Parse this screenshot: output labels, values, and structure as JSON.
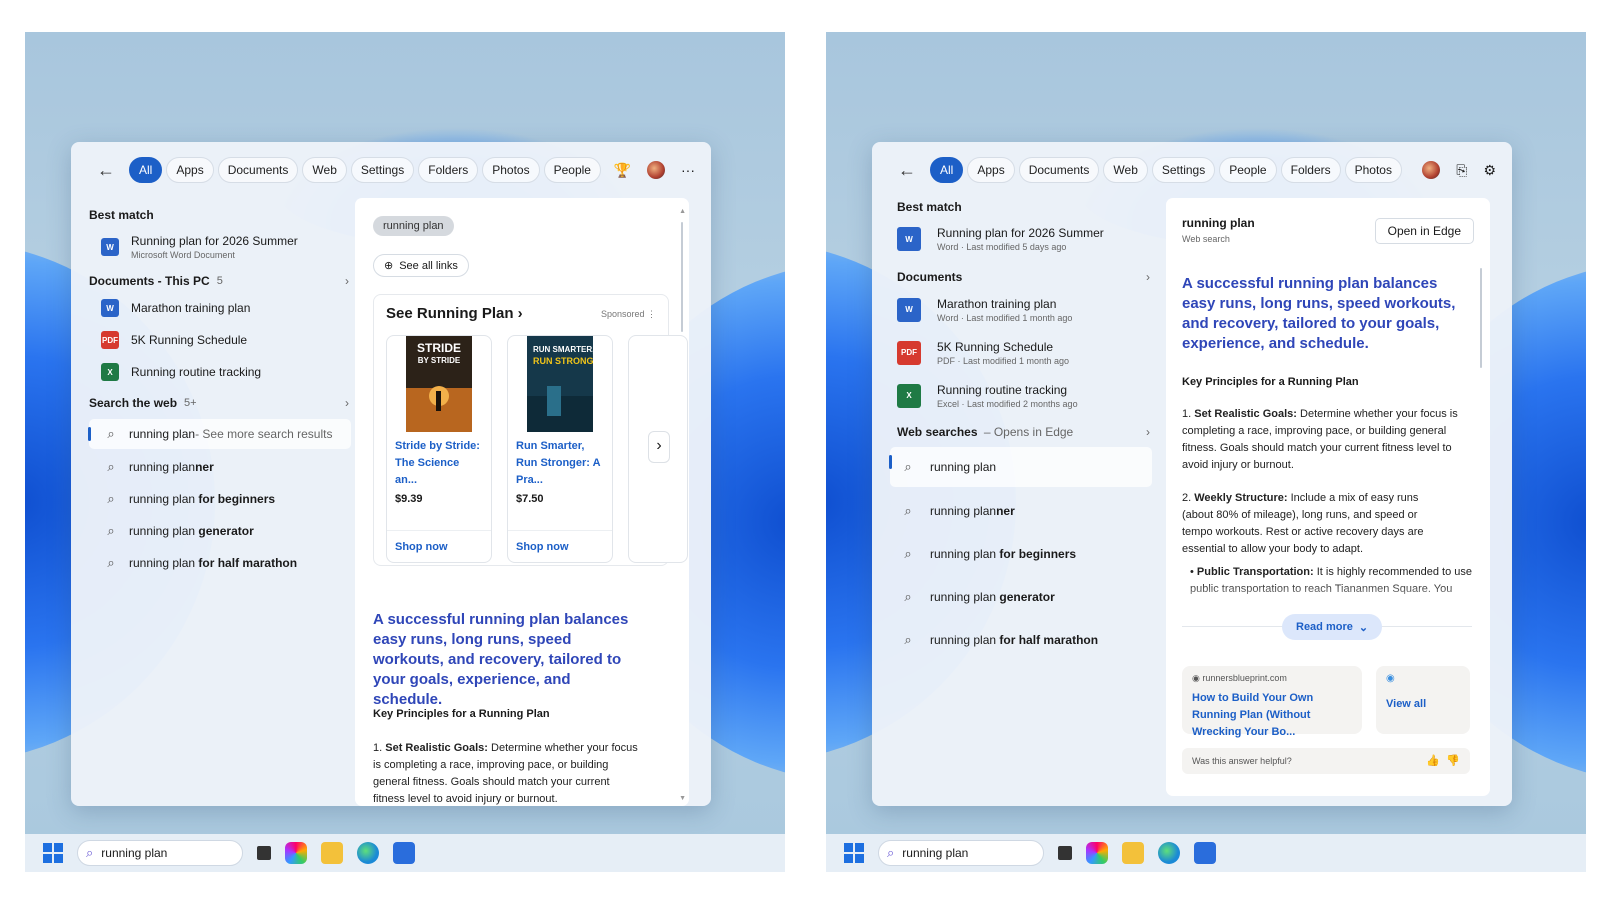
{
  "tabs1": [
    "All",
    "Apps",
    "Documents",
    "Web",
    "Settings",
    "Folders",
    "Photos",
    "People"
  ],
  "tabs2": [
    "All",
    "Apps",
    "Documents",
    "Web",
    "Settings",
    "People",
    "Folders",
    "Photos"
  ],
  "p1": {
    "best_match_h": "Best match",
    "best_title": "Running plan for 2026 Summer",
    "best_sub": "Microsoft Word Document",
    "docs_h": "Documents - This PC",
    "docs_count": "5",
    "docs": [
      "Marathon training plan",
      "5K Running Schedule",
      "Running routine tracking"
    ],
    "web_h": "Search the web",
    "web_count": "5+",
    "web_first": "running plan",
    "web_first_suffix": " - See more search results",
    "sugg_pre": [
      "running plan",
      "running plan",
      "running plan",
      "running plan"
    ],
    "sugg_bold": [
      "ner",
      " for beginners",
      " generator",
      " for half marathon"
    ],
    "chip": "running plan",
    "see_all": "See all links",
    "shop_h": "See Running Plan",
    "sponsored": "Sponsored",
    "book1": {
      "title": "Stride by Stride: The Science an...",
      "price": "$9.39",
      "shop": "Shop now",
      "cover1": "STRIDE",
      "cover2": "BY STRIDE"
    },
    "book2": {
      "title": "Run Smarter, Run Stronger: A Pra...",
      "price": "$7.50",
      "shop": "Shop now",
      "cover1": "RUN SMARTER,",
      "cover2": "RUN STRONGER"
    },
    "answer": "A successful running plan balances easy runs, long runs, speed workouts, and recovery, tailored to your goals, experience, and schedule.",
    "kp_h": "Key Principles for a Running Plan",
    "g1_num": "1. ",
    "g1_b": "Set Realistic Goals:",
    "g1_t": " Determine whether your focus is completing a race, improving pace, or building general fitness. Goals should match your current fitness level to avoid injury or burnout."
  },
  "p2": {
    "best_match_h": "Best match",
    "best_title": "Running plan for 2026 Summer",
    "best_sub": "Word · Last modified 5 days ago",
    "docs_h": "Documents",
    "docs": [
      {
        "t": "Marathon training plan",
        "s": "Word · Last modified 1 month ago"
      },
      {
        "t": "5K Running Schedule",
        "s": "PDF · Last modified 1 month ago"
      },
      {
        "t": "Running routine tracking",
        "s": "Excel · Last modified 2 months ago"
      }
    ],
    "web_h": "Web searches",
    "web_sub": " – Opens in Edge",
    "web_first": "running plan",
    "sugg_pre": [
      "running plan",
      "running plan",
      "running plan",
      "running plan"
    ],
    "sugg_bold": [
      "ner",
      " for beginners",
      " generator",
      " for half marathon"
    ],
    "q_title": "running plan",
    "q_sub": "Web search",
    "open_edge": "Open in Edge",
    "answer": "A successful running plan balances easy runs, long runs, speed workouts, and recovery, tailored to your goals, experience, and schedule.",
    "kp_h": "Key Principles for a Running Plan",
    "g1_num": "1. ",
    "g1_b": "Set Realistic Goals:",
    "g1_t": " Determine whether your focus is completing a race, improving pace, or building general fitness. Goals should match your current fitness level to avoid injury or burnout.",
    "g2_num": "2. ",
    "g2_b": "Weekly Structure:",
    "g2_t": " Include a mix of easy runs (about 80% of mileage), long runs, and speed or tempo workouts. Rest or active recovery days are essential to allow your body to adapt.",
    "bullet_b": "Public Transportation:",
    "bullet_t": " It is highly recommended to use public transportation to reach Tiananmen Square. You",
    "read_more": "Read more",
    "src_domain": "runnersblueprint.com",
    "src_title": "How to Build Your Own Running Plan (Without Wrecking Your Bo...",
    "view_all": "View all",
    "helpful": "Was this answer helpful?"
  },
  "taskbar_query": "running plan"
}
